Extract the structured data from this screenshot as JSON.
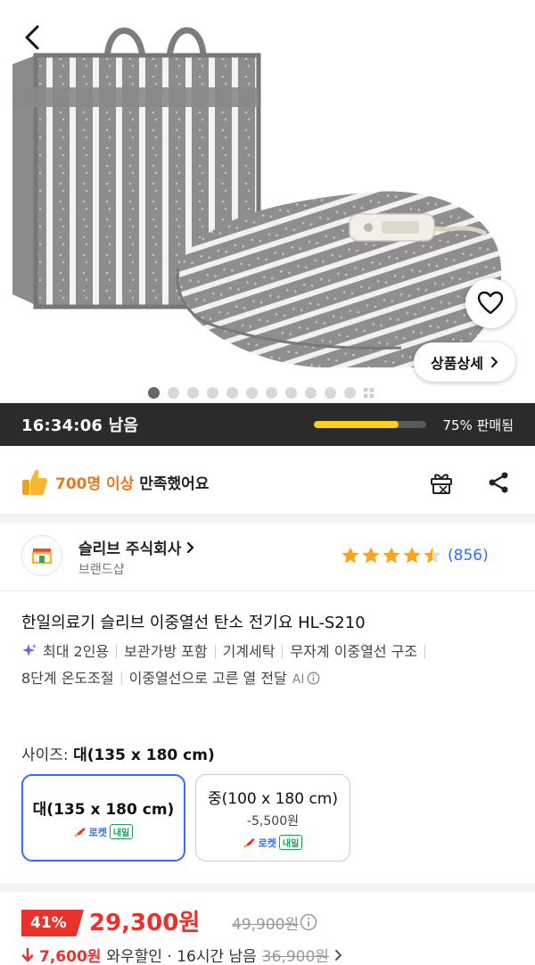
{
  "hero": {
    "detail_button_label": "상품상세",
    "dot_count": 11,
    "active_dot": 0
  },
  "timer": {
    "remaining": "16:34:06 남음",
    "sold_percent": 0.75,
    "sold_label": "75% 판매됨",
    "bar_color": "#ffd11a"
  },
  "satisfaction": {
    "highlight": "700명 이상",
    "text": " 만족했어요"
  },
  "seller": {
    "name": "슬리브 주식회사",
    "sub": "브랜드샵"
  },
  "rating": {
    "stars": 4.5,
    "review_count": "(856)"
  },
  "product": {
    "title": "한일의료기 슬리브 이중열선 탄소 전기요 HL-S210",
    "features": [
      "최대 2인용",
      "보관가방 포함",
      "기계세탁",
      "무자계 이중열선 구조",
      "8단계 온도조절",
      "이중열선으로 고른 열 전달"
    ],
    "ai_label": "AI"
  },
  "size": {
    "label": "사이즈: ",
    "selected_value": "대(135 x 180 cm)",
    "options": [
      {
        "name": "대(135 x 180 cm)",
        "price": "",
        "rocket": "로켓",
        "tag": "내일"
      },
      {
        "name": "중(100 x 180 cm)",
        "price": "-5,500원",
        "rocket": "로켓",
        "tag": "내일"
      }
    ]
  },
  "price": {
    "discount": "41%",
    "sale": "29,300원",
    "original": "49,900원"
  },
  "coupon": {
    "amount": "7,600원",
    "label": "와우할인 · 16시간 남음",
    "strike": "36,900원"
  },
  "colors": {
    "accent": "#346aff",
    "sale": "#e8322b",
    "rating": "#f5a623"
  }
}
